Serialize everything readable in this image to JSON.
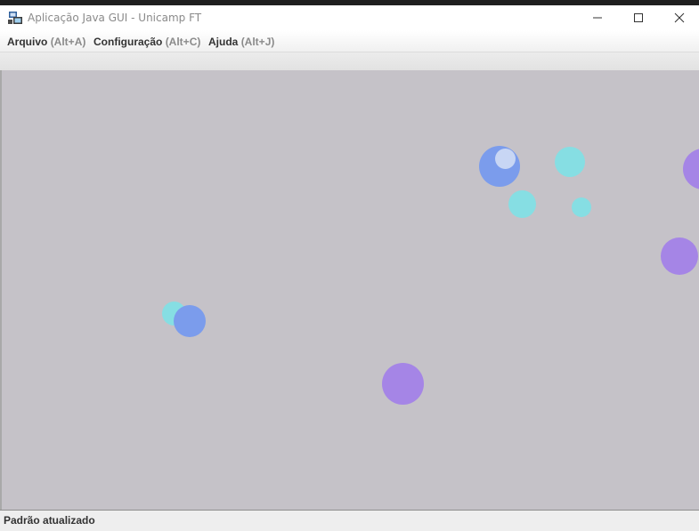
{
  "window": {
    "title": "Aplicação Java GUI - Unicamp FT",
    "icon": "java-app-icon",
    "controls": [
      "minimize-icon",
      "maximize-icon",
      "close-icon"
    ]
  },
  "menu": {
    "items": [
      {
        "label": "Arquivo",
        "mnemonic": "(Alt+A)"
      },
      {
        "label": "Configuração",
        "mnemonic": "(Alt+C)"
      },
      {
        "label": "Ajuda",
        "mnemonic": "(Alt+J)"
      }
    ]
  },
  "colors": {
    "canvas_background": "#c5c2c8",
    "ball_blue": "#7b9cec",
    "ball_cyan": "#86dee3",
    "ball_purple": "#a585e6",
    "ball_light": "#c8d6f4"
  },
  "status": {
    "text": "Padrão atualizado"
  }
}
